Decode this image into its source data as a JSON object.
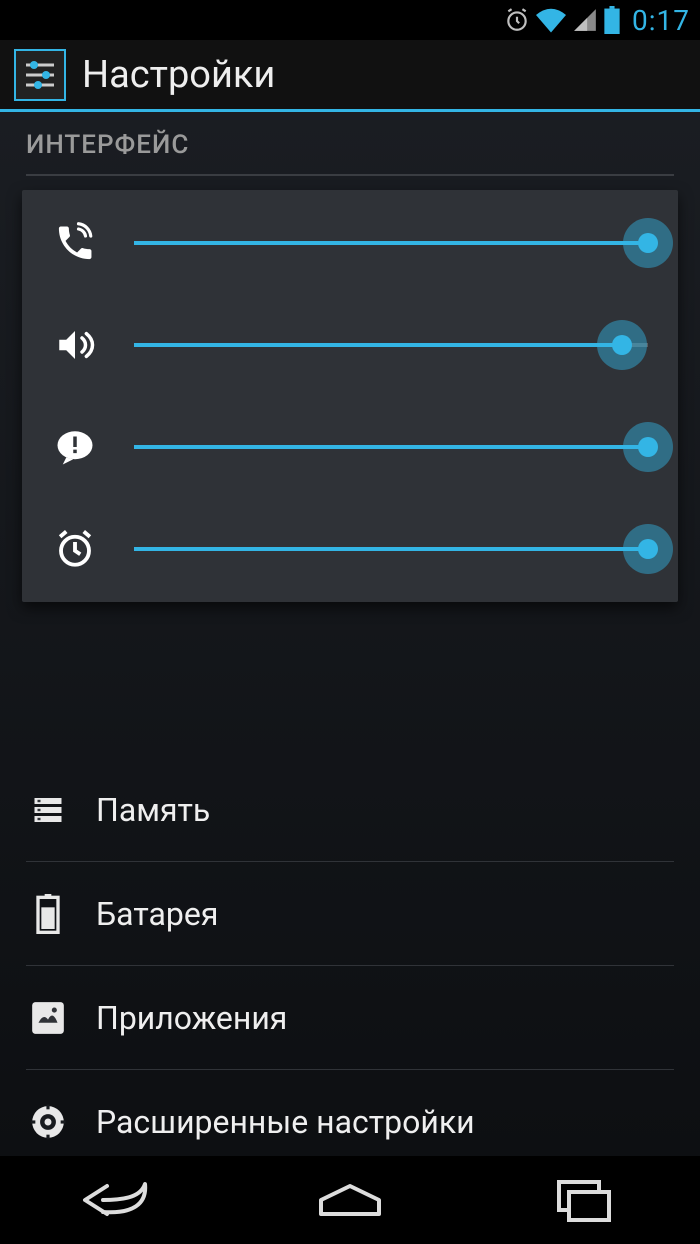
{
  "status": {
    "clock": "0:17"
  },
  "header": {
    "title": "Настройки"
  },
  "section": {
    "label": "ИНТЕРФЕЙС"
  },
  "volume": {
    "rows": [
      {
        "icon": "phone",
        "value": 100
      },
      {
        "icon": "speaker",
        "value": 95
      },
      {
        "icon": "notification",
        "value": 100
      },
      {
        "icon": "alarm",
        "value": 100
      }
    ]
  },
  "list": {
    "items": [
      {
        "icon": "storage",
        "label": "Память"
      },
      {
        "icon": "battery",
        "label": "Батарея"
      },
      {
        "icon": "apps",
        "label": "Приложения"
      },
      {
        "icon": "advanced",
        "label": "Расширенные настройки"
      }
    ]
  },
  "colors": {
    "accent": "#33b5e5"
  }
}
